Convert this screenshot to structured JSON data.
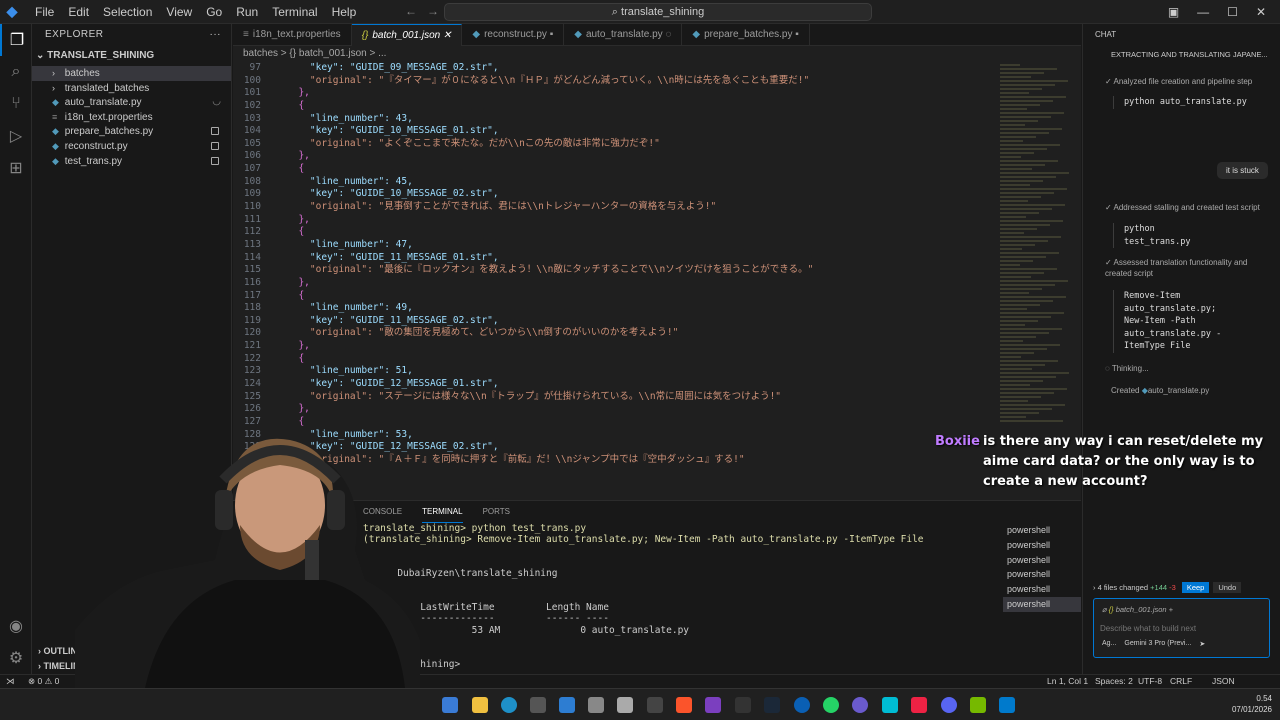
{
  "menu": [
    "File",
    "Edit",
    "Selection",
    "View",
    "Go",
    "Run",
    "Terminal",
    "Help"
  ],
  "search": "translate_shining",
  "explorer": {
    "title": "EXPLORER",
    "root": "TRANSLATE_SHINING",
    "items": [
      {
        "label": "batches",
        "type": "folder"
      },
      {
        "label": "translated_batches",
        "type": "folder"
      },
      {
        "label": "auto_translate.py",
        "type": "py"
      },
      {
        "label": "i18n_text.properties",
        "type": "prop"
      },
      {
        "label": "prepare_batches.py",
        "type": "py"
      },
      {
        "label": "reconstruct.py",
        "type": "py"
      },
      {
        "label": "test_trans.py",
        "type": "py"
      }
    ],
    "outline": "OUTLINE",
    "timeline": "TIMELINE"
  },
  "tabs": [
    "i18n_text.properties",
    "batch_001.json",
    "reconstruct.py",
    "auto_translate.py",
    "prepare_batches.py"
  ],
  "breadcrumb": "batches  >  {} batch_001.json  >  ...",
  "code": [
    {
      "n": "97",
      "t": "    \"key\": \"GUIDE_09_MESSAGE_02.str\","
    },
    {
      "n": "100",
      "t": "    \"original\": \"『タイマー』が０になると\\\\n『ＨＰ』がどんどん減っていく。\\\\n時には先を急ぐことも重要だ!\""
    },
    {
      "n": "101",
      "t": "  },"
    },
    {
      "n": "102",
      "t": "  {"
    },
    {
      "n": "103",
      "t": "    \"line_number\": 43,"
    },
    {
      "n": "104",
      "t": "    \"key\": \"GUIDE_10_MESSAGE_01.str\","
    },
    {
      "n": "105",
      "t": "    \"original\": \"よくぞここまで来たな。だが\\\\nこの先の敵は非常に強力だぞ!\""
    },
    {
      "n": "106",
      "t": "  },"
    },
    {
      "n": "107",
      "t": "  {"
    },
    {
      "n": "108",
      "t": "    \"line_number\": 45,"
    },
    {
      "n": "109",
      "t": "    \"key\": \"GUIDE_10_MESSAGE_02.str\","
    },
    {
      "n": "110",
      "t": "    \"original\": \"見事倒すことができれば、君には\\\\nトレジャーハンターの資格を与えよう!\""
    },
    {
      "n": "111",
      "t": "  },"
    },
    {
      "n": "112",
      "t": "  {"
    },
    {
      "n": "113",
      "t": "    \"line_number\": 47,"
    },
    {
      "n": "114",
      "t": "    \"key\": \"GUIDE_11_MESSAGE_01.str\","
    },
    {
      "n": "115",
      "t": "    \"original\": \"最後に『ロックオン』を教えよう！\\\\n敵にタッチすることで\\\\nソイツだけを狙うことができる。\""
    },
    {
      "n": "116",
      "t": "  },"
    },
    {
      "n": "117",
      "t": "  {"
    },
    {
      "n": "118",
      "t": "    \"line_number\": 49,"
    },
    {
      "n": "119",
      "t": "    \"key\": \"GUIDE_11_MESSAGE_02.str\","
    },
    {
      "n": "120",
      "t": "    \"original\": \"敵の集団を見極めて、どいつから\\\\n倒すのがいいのかを考えよう!\""
    },
    {
      "n": "121",
      "t": "  },"
    },
    {
      "n": "122",
      "t": "  {"
    },
    {
      "n": "123",
      "t": "    \"line_number\": 51,"
    },
    {
      "n": "124",
      "t": "    \"key\": \"GUIDE_12_MESSAGE_01.str\","
    },
    {
      "n": "125",
      "t": "    \"original\": \"ステージには様々な\\\\n『トラップ』が仕掛けられている。\\\\n常に周囲には気をつけよう!\""
    },
    {
      "n": "126",
      "t": "  },"
    },
    {
      "n": "127",
      "t": "  {"
    },
    {
      "n": "128",
      "t": "    \"line_number\": 53,"
    },
    {
      "n": "129",
      "t": "    \"key\": \"GUIDE_12_MESSAGE_02.str\","
    },
    {
      "n": "130",
      "t": "    \"original\": \"『Ａ＋Ｆ』を同時に押すと『前転』だ！\\\\nジャンプ中では『空中ダッシュ』する!\""
    }
  ],
  "panel": {
    "tabs": [
      "OUTPUT",
      "CONSOLE",
      "TERMINAL",
      "PORTS"
    ]
  },
  "terminal": [
    "translate_shining> python test_trans.py",
    "(translate_shining> Remove-Item auto_translate.py; New-Item -Path auto_translate.py -ItemType File",
    "",
    "",
    "      DubaiRyzen\\translate_shining",
    "",
    "",
    "          LastWriteTime         Length Name",
    "          -------------         ------ ----",
    "                   53 AM              0 auto_translate.py",
    "",
    "",
    "      te_shining>"
  ],
  "terminal_list": [
    "powershell",
    "powershell",
    "powershell",
    "powershell",
    "powershell",
    "powershell"
  ],
  "chat": {
    "header": "CHAT",
    "subtitle": "EXTRACTING AND TRANSLATING JAPANE...",
    "step1": "Analyzed file creation and pipeline step",
    "cmd1": "python auto_translate.py",
    "user_msg": "it is stuck",
    "step2": "Addressed stalling and created test script",
    "cmd2": "python\ntest_trans.py",
    "step3": "Assessed translation functionality and created script",
    "cmd3": "Remove-Item\nauto_translate.py;\nNew-Item -Path\nauto_translate.py -\nItemType File",
    "thinking": "Thinking...",
    "created": "Created",
    "created_file": "auto_translate.py",
    "changes": "4 files changed",
    "added": "+144",
    "removed": "-3",
    "keep": "Keep",
    "undo": "Undo",
    "context_file": "batch_001.json",
    "placeholder": "Describe what to build next",
    "agent": "Ag...",
    "model": "Gemini 3 Pro (Previ..."
  },
  "status": {
    "errors": "0",
    "warnings": "0",
    "position": "Ln 1, Col 1",
    "spaces": "Spaces: 2",
    "encoding": "UTF-8",
    "eol": "CRLF",
    "lang": "JSON"
  },
  "taskbar": {
    "time": "0.54",
    "date": "07/01/2026"
  },
  "overlay": {
    "username": "Boxiie",
    "message": "is there any way i can reset/delete my aime card data? or the only way is to create a new account?"
  }
}
